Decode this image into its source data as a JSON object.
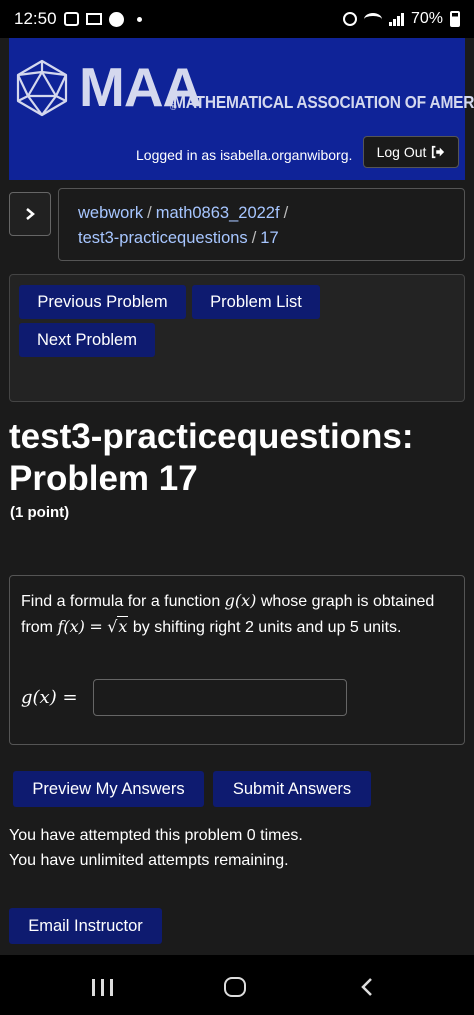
{
  "status_bar": {
    "time": "12:50",
    "battery": "70%"
  },
  "header": {
    "logo_text": "MAA",
    "org_name": "MATHEMATICAL ASSOCIATION OF AMERICA",
    "logged_in_text": "Logged in as isabella.organwiborg.",
    "logout_label": "Log Out",
    "brand_color": "#0f2398"
  },
  "breadcrumb": {
    "items": [
      "webwork",
      "math0863_2022f",
      "test3-practicequestions",
      "17"
    ]
  },
  "nav_buttons": {
    "previous": "Previous Problem",
    "list": "Problem List",
    "next": "Next Problem"
  },
  "problem": {
    "title_line1": "test3-practicequestions:",
    "title_line2": "Problem 17",
    "points": "(1 point)",
    "text_part1": "Find a formula for a function",
    "text_part2": "whose graph is obtained from",
    "text_part3": "by shifting right 2 units and up 5 units.",
    "math_g": "g(x)",
    "math_f": "f(x)",
    "math_eq": "=",
    "math_radicand": "x",
    "answer_label": "g(x) =",
    "answer_value": ""
  },
  "actions": {
    "preview": "Preview My Answers",
    "submit": "Submit Answers",
    "attempts_line1": "You have attempted this problem 0 times.",
    "attempts_line2": "You have unlimited attempts remaining.",
    "email": "Email Instructor",
    "button_color": "#0e1b70"
  },
  "icons": {
    "logout": "logout-arrow-icon",
    "toggle": "chevron-right-icon",
    "logo": "icosahedron-logo-icon"
  }
}
